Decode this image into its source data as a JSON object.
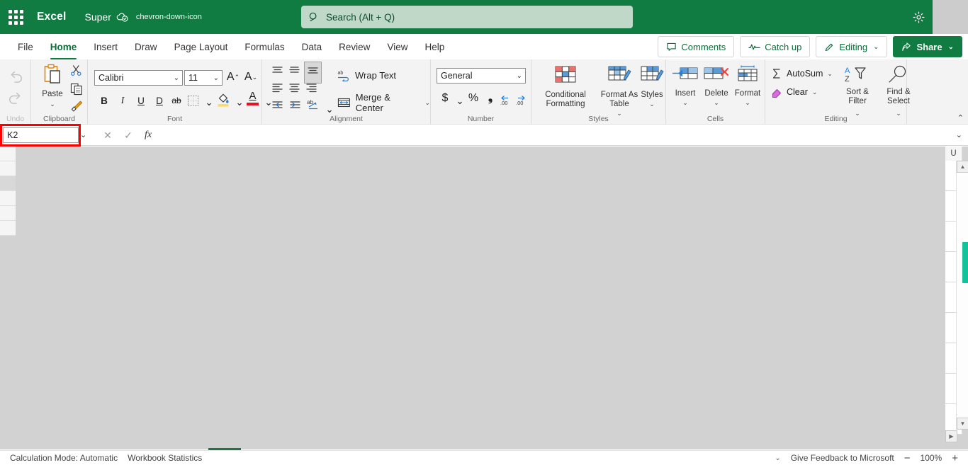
{
  "topbar": {
    "app_launcher": "app-launcher",
    "brand": "Excel",
    "doc_name": "Super",
    "cloud_status_icon": "cloud-saved-icon",
    "doc_menu_chevron": "chevron-down-icon",
    "settings_icon": "gear-icon",
    "accent_green": "#107c41"
  },
  "search": {
    "icon": "search-icon",
    "placeholder": "Search (Alt + Q)"
  },
  "tabs": [
    {
      "label": "File",
      "active": false
    },
    {
      "label": "Home",
      "active": true
    },
    {
      "label": "Insert",
      "active": false
    },
    {
      "label": "Draw",
      "active": false
    },
    {
      "label": "Page Layout",
      "active": false
    },
    {
      "label": "Formulas",
      "active": false
    },
    {
      "label": "Data",
      "active": false
    },
    {
      "label": "Review",
      "active": false
    },
    {
      "label": "View",
      "active": false
    },
    {
      "label": "Help",
      "active": false
    }
  ],
  "right_actions": {
    "comments": "Comments",
    "catch_up": "Catch up",
    "editing": "Editing",
    "share": "Share",
    "chevron": "⌄"
  },
  "ribbon": {
    "collapse_chevron": "⌃",
    "groups": [
      {
        "name": "Undo",
        "label": "Undo"
      },
      {
        "name": "Clipboard",
        "label": "Clipboard"
      },
      {
        "name": "Font",
        "label": "Font"
      },
      {
        "name": "Alignment",
        "label": "Alignment"
      },
      {
        "name": "Number",
        "label": "Number"
      },
      {
        "name": "Styles",
        "label": "Styles"
      },
      {
        "name": "Cells",
        "label": "Cells"
      },
      {
        "name": "Editing",
        "label": "Editing"
      }
    ],
    "clipboard": {
      "paste": "Paste",
      "paste_caret": "⌄",
      "cut_icon": "scissors-icon",
      "copy_icon": "copy-icon",
      "format_painter_icon": "format-painter-icon"
    },
    "font": {
      "font_family_value": "Calibri",
      "font_size_value": "11",
      "grow_font": "A",
      "shrink_font": "A",
      "bold": "B",
      "italic": "I",
      "underline": "U",
      "double_underline": "D",
      "strikethrough": "ab",
      "borders_icon": "borders-icon",
      "fill_color_icon": "fill-color-icon",
      "font_color_letter": "A"
    },
    "alignment": {
      "wrap_text": "Wrap Text",
      "merge_center": "Merge & Center",
      "wrap_icon": "wrap-text-icon",
      "merge_icon": "merge-cells-icon"
    },
    "number": {
      "format_value": "General",
      "currency": "$",
      "percent": "%",
      "comma": "❟",
      "increase_decimal": "←0 .00",
      "decrease_decimal": ".00 →0"
    },
    "styles": {
      "conditional_formatting": "Conditional Formatting",
      "format_as_table": "Format As Table",
      "styles": "Styles"
    },
    "cells": {
      "insert": "Insert",
      "delete": "Delete",
      "format": "Format"
    },
    "editing": {
      "autosum": "AutoSum",
      "clear": "Clear",
      "sort_filter": "Sort & Filter",
      "find_select": "Find & Select"
    }
  },
  "formula_bar": {
    "name_box_value": "K2",
    "name_box_chevron": "⌄",
    "cancel_icon": "cancel-icon",
    "confirm_icon": "confirm-icon",
    "function_icon": "fx",
    "formula_value": "",
    "expand_chevron": "⌄",
    "highlight_color": "#ff0000"
  },
  "grid": {
    "visible_column_header": "U",
    "scroll_thumb_color": "#13c29a",
    "scroll_up_icon": "▲",
    "scroll_down_icon": "▼",
    "scroll_right_icon": "▶"
  },
  "status_bar": {
    "calculation_mode": "Calculation Mode: Automatic",
    "workbook_statistics": "Workbook Statistics",
    "options_chevron": "⌄",
    "feedback": "Give Feedback to Microsoft",
    "zoom_out": "−",
    "zoom_level": "100%",
    "zoom_in": "+"
  }
}
